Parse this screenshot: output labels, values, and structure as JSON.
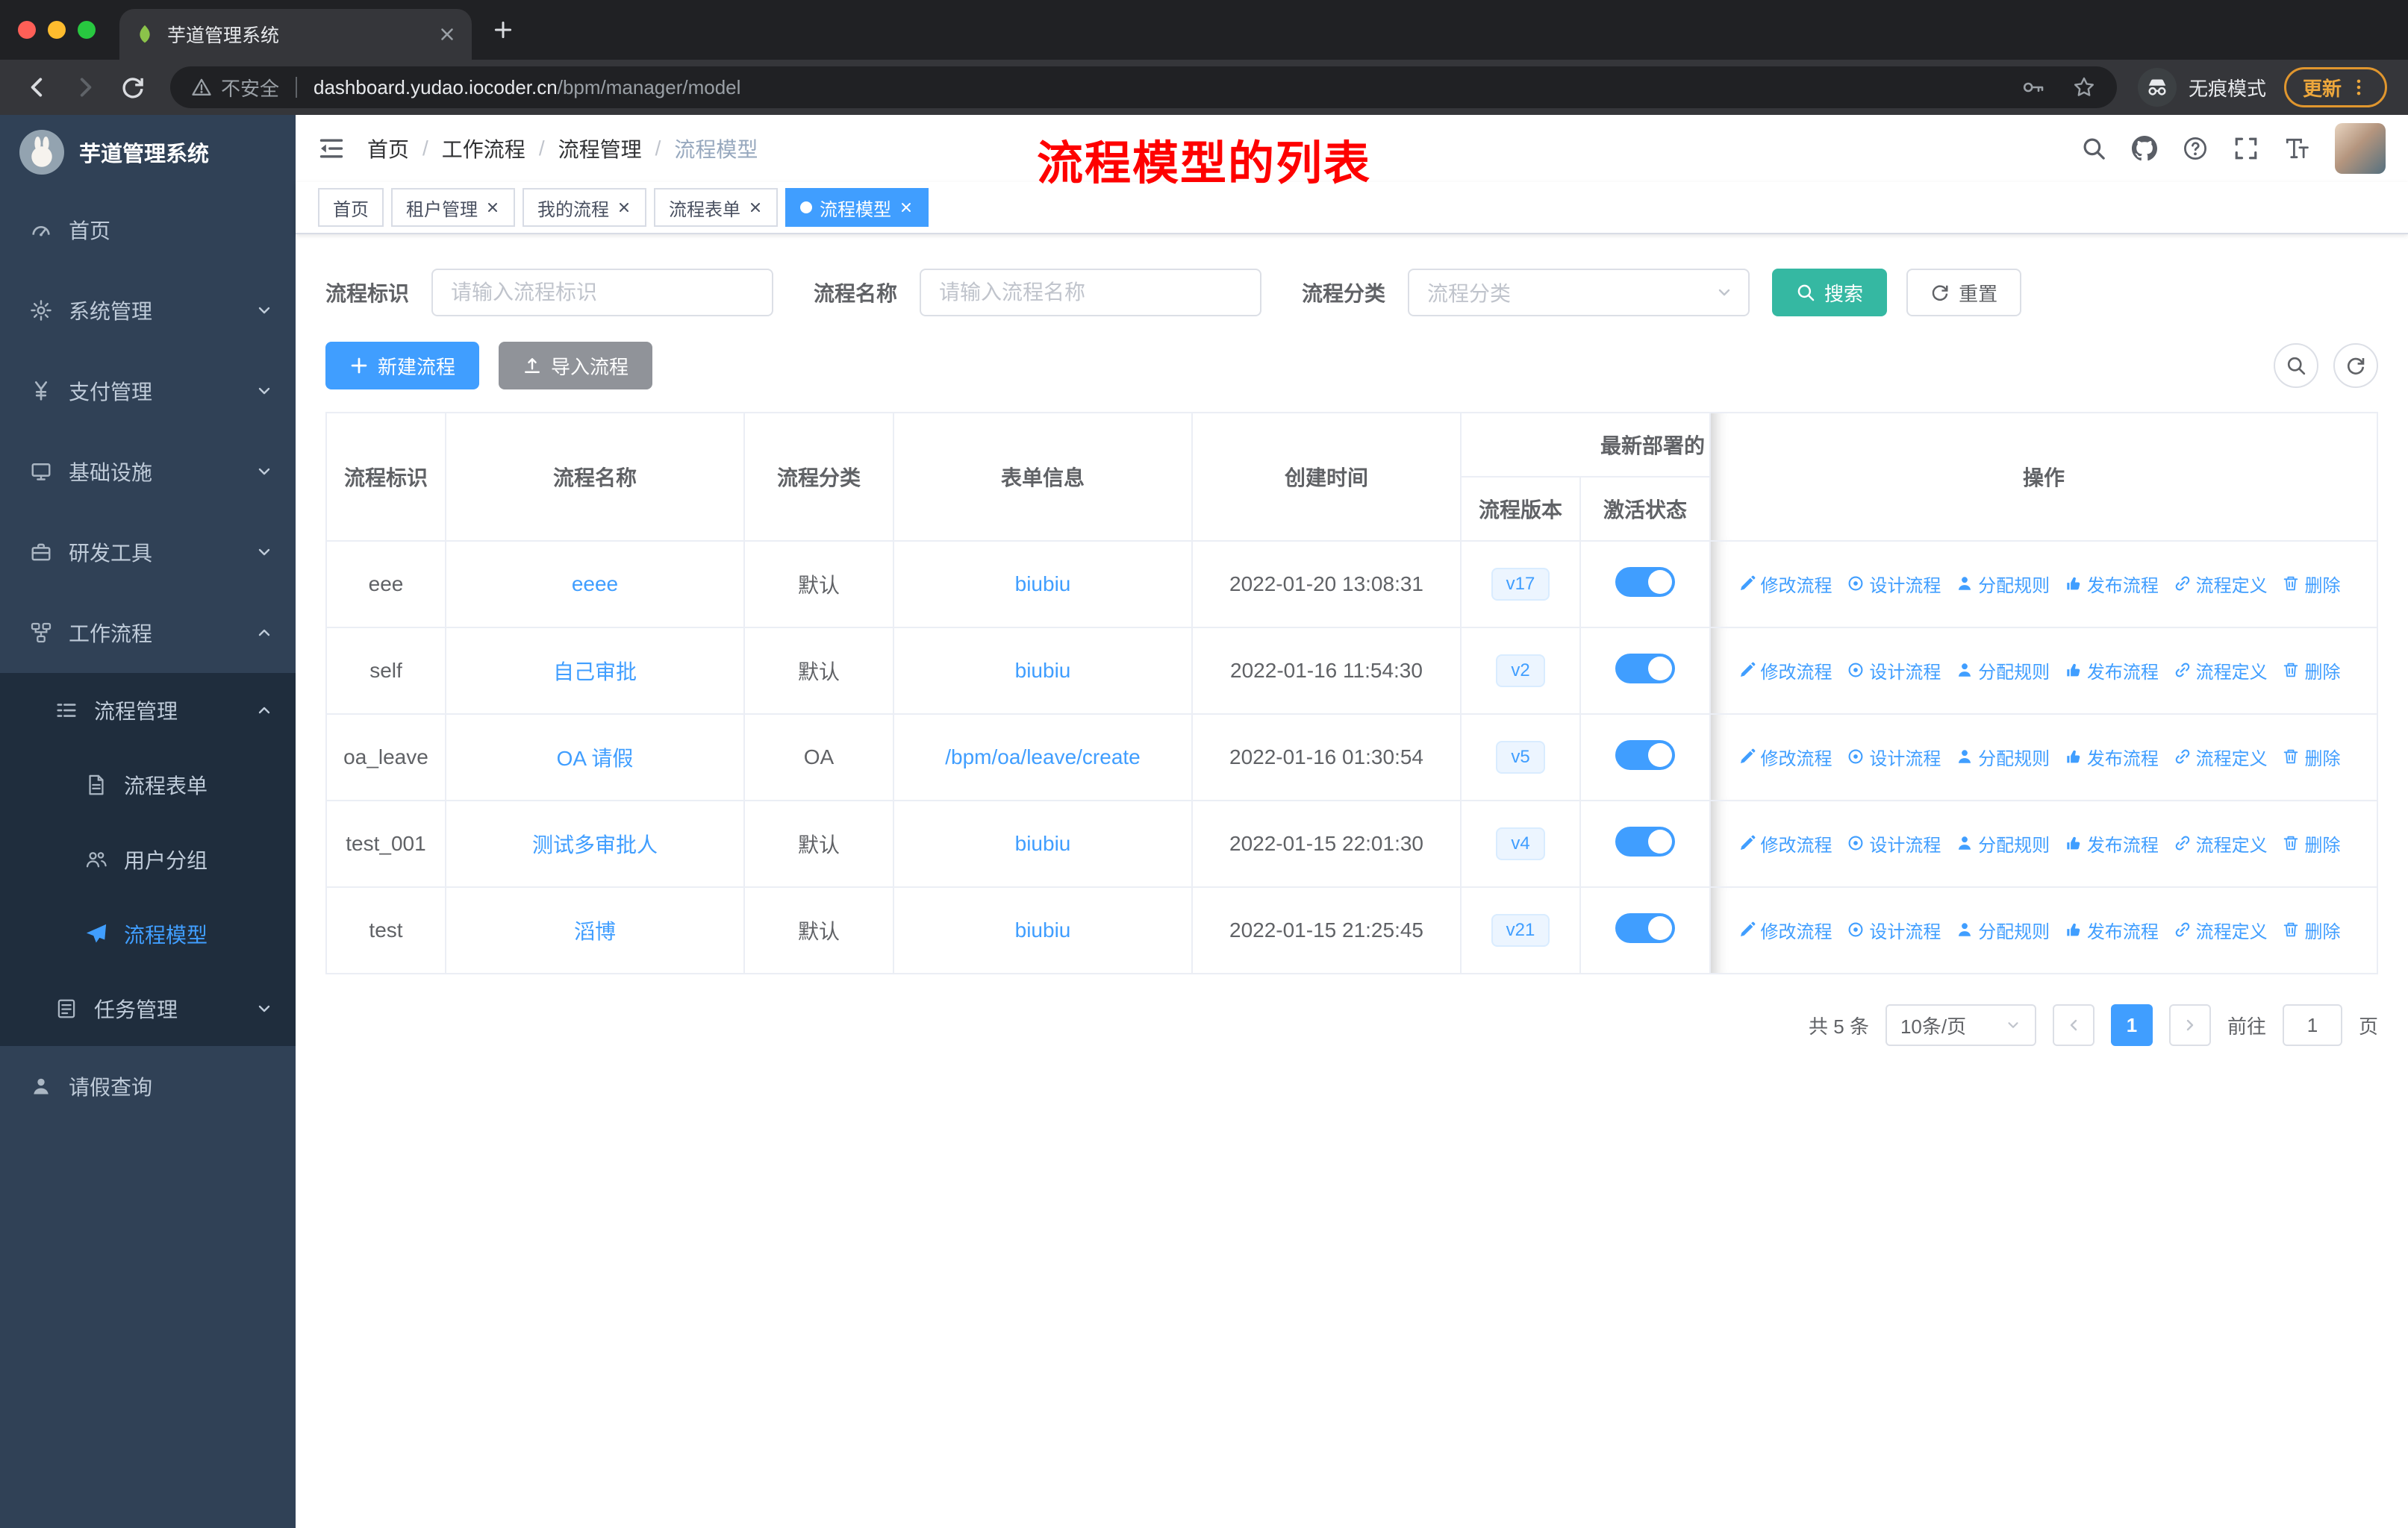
{
  "browser": {
    "tab_title": "芋道管理系统",
    "security_label": "不安全",
    "url_host": "dashboard.yudao.iocoder.cn",
    "url_path": "/bpm/manager/model",
    "incognito_label": "无痕模式",
    "update_label": "更新"
  },
  "annotation": "流程模型的列表",
  "sidebar": {
    "title": "芋道管理系统",
    "menu": [
      {
        "label": "首页"
      },
      {
        "label": "系统管理"
      },
      {
        "label": "支付管理"
      },
      {
        "label": "基础设施"
      },
      {
        "label": "研发工具"
      },
      {
        "label": "工作流程"
      },
      {
        "label": "流程管理"
      },
      {
        "label": "流程表单"
      },
      {
        "label": "用户分组"
      },
      {
        "label": "流程模型"
      },
      {
        "label": "任务管理"
      },
      {
        "label": "请假查询"
      }
    ]
  },
  "header": {
    "breadcrumb": [
      "首页",
      "工作流程",
      "流程管理",
      "流程模型"
    ],
    "separator": "/"
  },
  "tags": [
    {
      "label": "首页"
    },
    {
      "label": "租户管理"
    },
    {
      "label": "我的流程"
    },
    {
      "label": "流程表单"
    },
    {
      "label": "流程模型"
    }
  ],
  "filters": {
    "key_label": "流程标识",
    "key_placeholder": "请输入流程标识",
    "name_label": "流程名称",
    "name_placeholder": "请输入流程名称",
    "category_label": "流程分类",
    "category_placeholder": "流程分类",
    "search_label": "搜索",
    "reset_label": "重置"
  },
  "toolbar": {
    "create_label": "新建流程",
    "import_label": "导入流程"
  },
  "table": {
    "headers": {
      "id": "流程标识",
      "name": "流程名称",
      "category": "流程分类",
      "form": "表单信息",
      "created": "创建时间",
      "deploy_group": "最新部署的",
      "version": "流程版本",
      "active": "激活状态",
      "actions": "操作"
    },
    "action_labels": [
      "修改流程",
      "设计流程",
      "分配规则",
      "发布流程",
      "流程定义",
      "删除"
    ],
    "rows": [
      {
        "id": "eee",
        "name": "eeee",
        "category": "默认",
        "form": "biubiu",
        "created": "2022-01-20 13:08:31",
        "version": "v17",
        "active": true
      },
      {
        "id": "self",
        "name": "自己审批",
        "category": "默认",
        "form": "biubiu",
        "created": "2022-01-16 11:54:30",
        "version": "v2",
        "active": true
      },
      {
        "id": "oa_leave",
        "name": "OA 请假",
        "category": "OA",
        "form": "/bpm/oa/leave/create",
        "created": "2022-01-16 01:30:54",
        "version": "v5",
        "active": true
      },
      {
        "id": "test_001",
        "name": "测试多审批人",
        "category": "默认",
        "form": "biubiu",
        "created": "2022-01-15 22:01:30",
        "version": "v4",
        "active": true
      },
      {
        "id": "test",
        "name": "滔博",
        "category": "默认",
        "form": "biubiu",
        "created": "2022-01-15 21:25:45",
        "version": "v21",
        "active": true
      }
    ]
  },
  "pagination": {
    "total": "共 5 条",
    "page_size": "10条/页",
    "current_page": "1",
    "goto_label": "前往",
    "goto_value": "1",
    "unit_label": "页"
  },
  "colors": {
    "primary": "#409EFF",
    "search_button_teal": "#35B8A2",
    "sidebar_bg": "#304156",
    "sidebar_submenu_bg": "#1F2D3D",
    "annotation_red": "#FE0100",
    "version_tag_bg": "#ECF5FF",
    "toggle_on": "#409EFF",
    "update_pill_orange": "#EDA73C"
  },
  "icons": {
    "tab-favicon": "green-leaf",
    "security-warning-icon": "triangle-exclamation",
    "incognito-icon": "spy-hat-glasses",
    "search-icon": "magnifier",
    "github-icon": "octocat",
    "help-icon": "question-circle",
    "fullscreen-icon": "expand-corners",
    "font-size-icon": "double-T",
    "action-edit-icon": "pencil",
    "action-design-icon": "circle-dot",
    "action-assign-icon": "user",
    "action-publish-icon": "thumb-up",
    "action-definition-icon": "chain-link",
    "action-delete-icon": "trash"
  }
}
